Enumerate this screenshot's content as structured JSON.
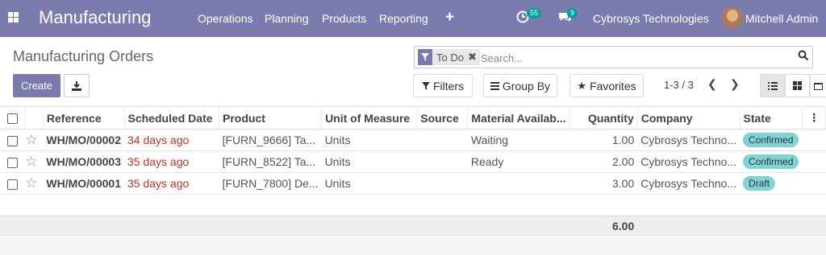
{
  "nav": {
    "brand": "Manufacturing",
    "menu": [
      "Operations",
      "Planning",
      "Products",
      "Reporting"
    ],
    "plus": "+",
    "activity_count": "55",
    "message_count": "9",
    "company": "Cybrosys Technologies",
    "user": "Mitchell Admin"
  },
  "page": {
    "title": "Manufacturing Orders",
    "create_label": "Create"
  },
  "search": {
    "facet": "To Do",
    "placeholder": "Search..."
  },
  "filters": {
    "filters_label": "Filters",
    "groupby_label": "Group By",
    "favorites_label": "Favorites"
  },
  "pager": {
    "value": "1-3 / 3"
  },
  "table": {
    "headers": [
      "Reference",
      "Scheduled Date",
      "Product",
      "Unit of Measure",
      "Source",
      "Material Availab...",
      "Quantity",
      "Company",
      "State"
    ],
    "rows": [
      {
        "reference": "WH/MO/00002",
        "date": "34 days ago",
        "product": "[FURN_9666] Ta...",
        "uom": "Units",
        "source": "",
        "material": "Waiting",
        "quantity": "1.00",
        "company": "Cybrosys Techno...",
        "state": "Confirmed"
      },
      {
        "reference": "WH/MO/00003",
        "date": "35 days ago",
        "product": "[FURN_8522] Ta...",
        "uom": "Units",
        "source": "",
        "material": "Ready",
        "quantity": "2.00",
        "company": "Cybrosys Techno...",
        "state": "Confirmed"
      },
      {
        "reference": "WH/MO/00001",
        "date": "35 days ago",
        "product": "[FURN_7800] De...",
        "uom": "Units",
        "source": "",
        "material": "",
        "quantity": "3.00",
        "company": "Cybrosys Techno...",
        "state": "Draft"
      }
    ],
    "total_quantity": "6.00"
  },
  "colors": {
    "brand": "#7c7bad",
    "late": "#c9302c",
    "state_pill": "#7dd4d4",
    "badge": "#00a09d"
  }
}
